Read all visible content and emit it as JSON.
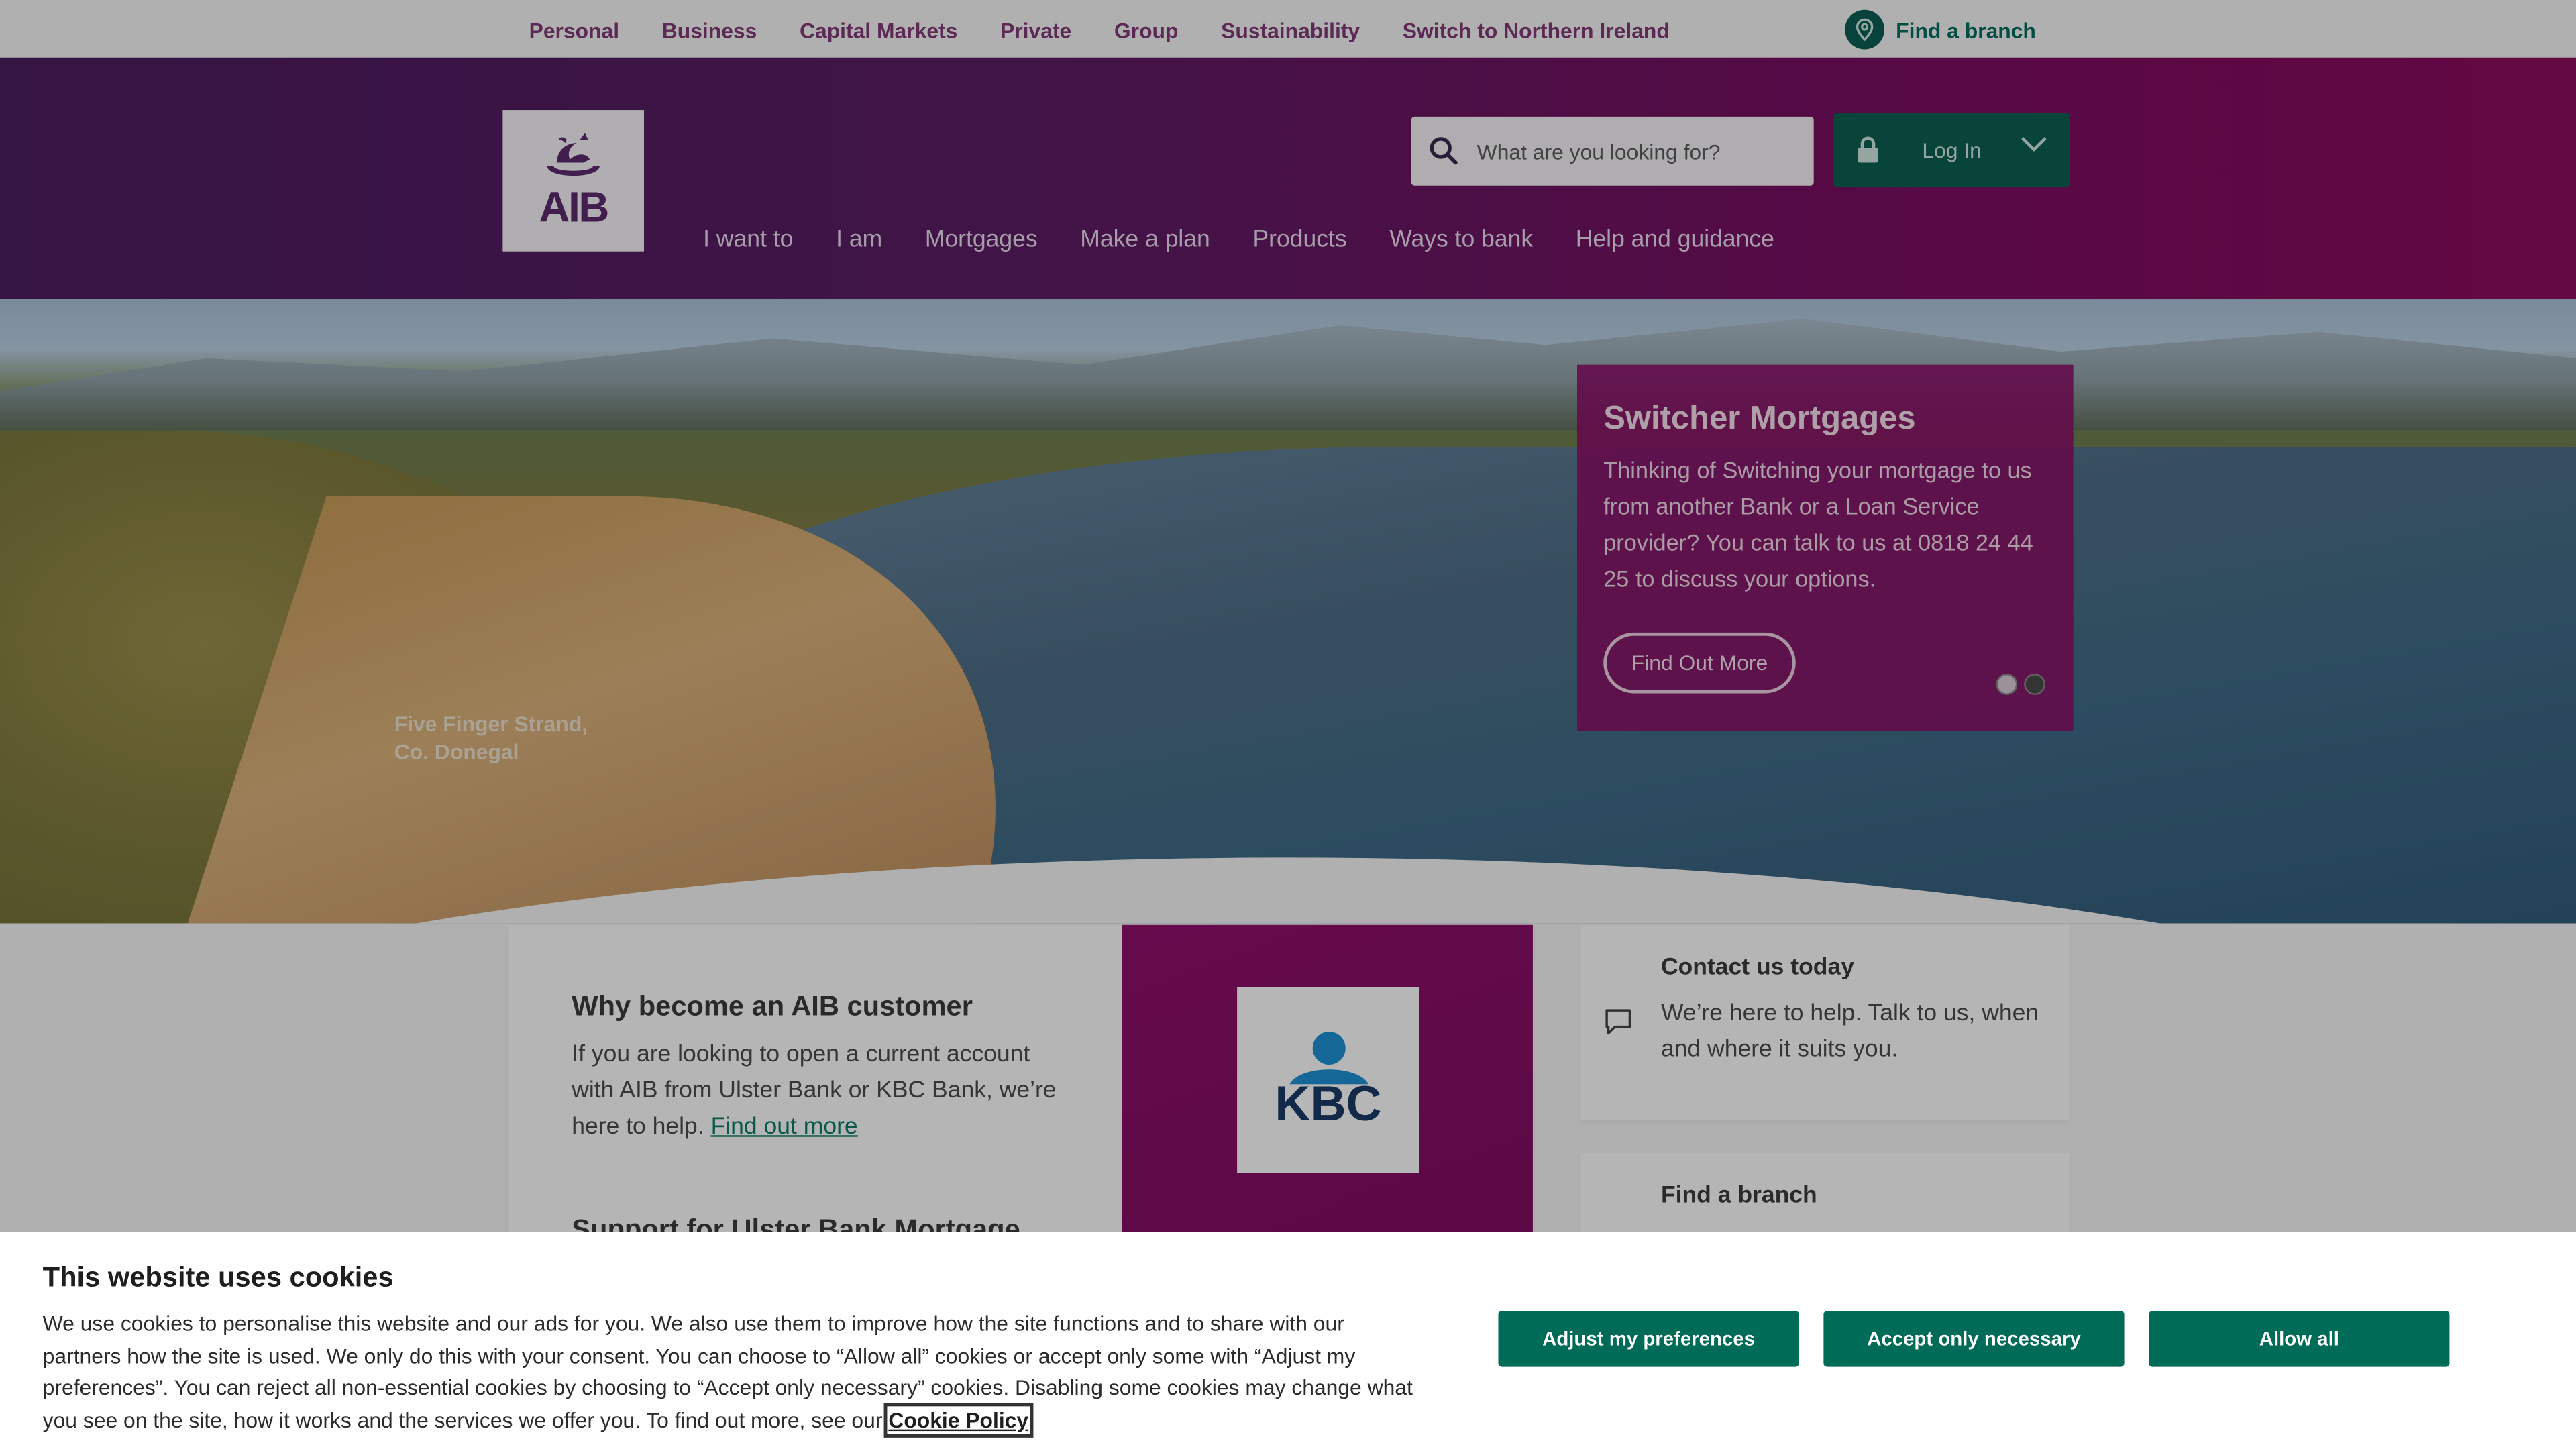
{
  "topbar": {
    "links": [
      "Personal",
      "Business",
      "Capital Markets",
      "Private",
      "Group",
      "Sustainability",
      "Switch to Northern Ireland"
    ],
    "find_branch": "Find a branch"
  },
  "header": {
    "logo_text": "AIB",
    "nav": [
      "I want to",
      "I am",
      "Mortgages",
      "Make a plan",
      "Products",
      "Ways to bank",
      "Help and guidance"
    ],
    "search_placeholder": "What are you looking for?",
    "login_label": "Log In"
  },
  "hero": {
    "caption_line1": "Five Finger Strand,",
    "caption_line2": "Co. Donegal",
    "promo_title": "Switcher Mortgages",
    "promo_text": "Thinking of Switching your mortgage to us from another Bank or a Loan Service provider? You can talk to us at 0818 24 44 25 to discuss your options.",
    "promo_button": "Find Out More",
    "carousel_slides": 2,
    "carousel_active": 2
  },
  "main_card": {
    "title": "Why become an AIB customer",
    "text": "If you are looking to open a current account with AIB from Ulster Bank or KBC Bank, we’re here to help.",
    "link": "Find out more",
    "subtitle": "Support for Ulster Bank Mortgage",
    "partner_logo": "KBC"
  },
  "side_cards": [
    {
      "title": "Contact us today",
      "text": "We’re here to help. Talk to us, when and where it suits you.",
      "icon": "chat-icon"
    },
    {
      "title": "Find a branch",
      "text": "",
      "icon": "location-icon"
    }
  ],
  "cookie": {
    "title": "This website uses cookies",
    "text": "We use cookies to personalise this website and our ads for you. We also use them to improve how the site functions and to share with our partners how the site is used. We only do this with your consent. You can choose to “Allow all” cookies or accept only some with “Adjust my preferences”. You can reject all non-essential cookies by choosing to “Accept only necessary” cookies. Disabling some cookies may change what you see on the site, how it works and the services we offer you. To find out more, see our",
    "policy_link": "Cookie Policy",
    "buttons": {
      "adjust": "Adjust my preferences",
      "necessary": "Accept only necessary",
      "allow": "Allow all"
    }
  },
  "colors": {
    "brand_purple": "#6b1a5e",
    "brand_green": "#006b56",
    "promo_magenta": "#8a0e66"
  }
}
